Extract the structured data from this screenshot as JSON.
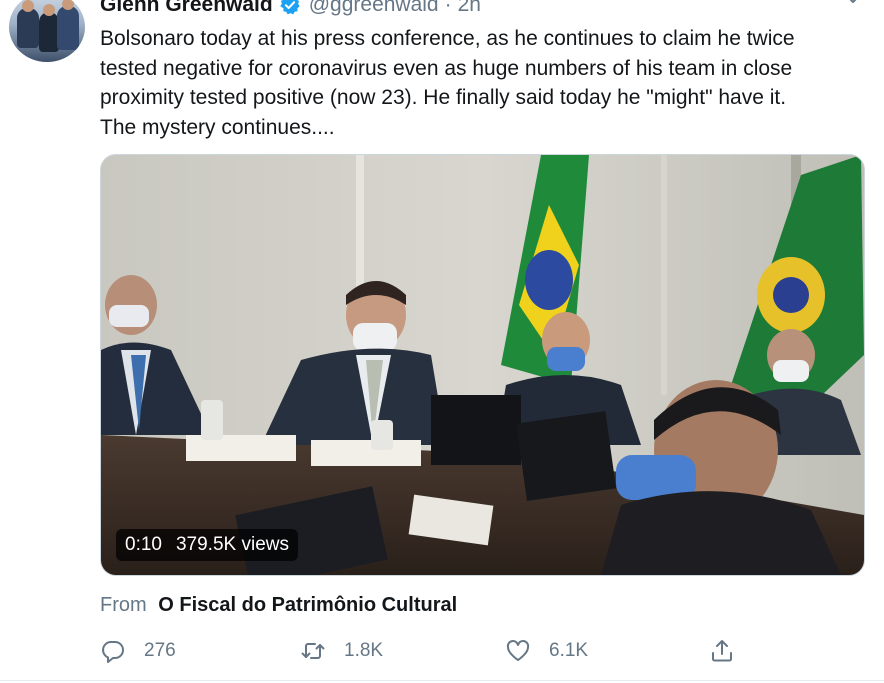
{
  "tweet": {
    "author_name": "Glenn Greenwald",
    "handle": "@ggreenwald",
    "separator": "·",
    "timestamp": "2h",
    "verified": true,
    "text": "Bolsonaro today at his press conference, as he continues to claim he twice\ntested negative for coronavirus even as huge numbers of his team in close\nproximity tested positive (now 23). He finally said today he \"might\" have it.\nThe mystery continues....",
    "media": {
      "type": "video",
      "duration": "0:10",
      "views": "379.5K views"
    },
    "source": {
      "prefix": "From",
      "account": "O Fiscal do Patrimônio Cultural"
    },
    "actions": {
      "replies": "276",
      "retweets": "1.8K",
      "likes": "6.1K"
    }
  },
  "icons": {
    "verified": "verified-badge-icon",
    "more": "chevron-down-icon",
    "reply": "reply-icon",
    "retweet": "retweet-icon",
    "like": "heart-icon",
    "share": "share-icon"
  },
  "colors": {
    "verified_blue": "#1da1f2",
    "secondary_text": "#657786",
    "primary_text": "#14171a"
  }
}
